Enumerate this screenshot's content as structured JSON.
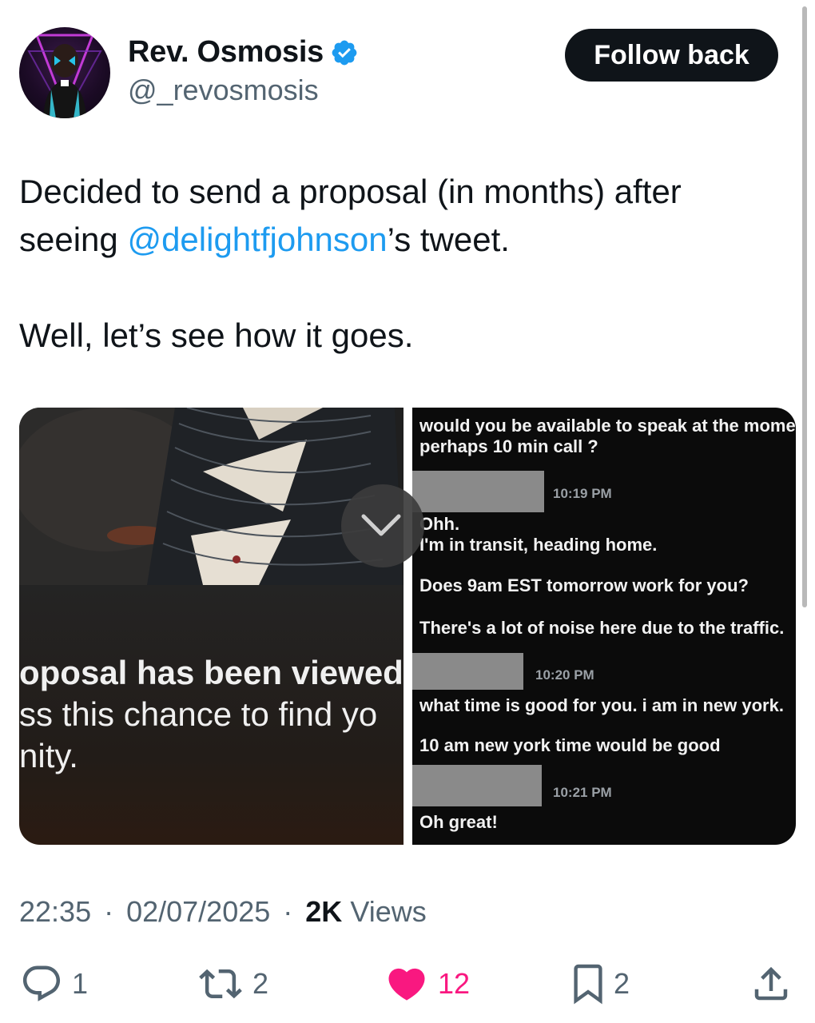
{
  "author": {
    "display_name": "Rev. Osmosis",
    "handle": "@_revosmosis",
    "verified": true,
    "follow_label": "Follow back"
  },
  "tweet": {
    "line1": "Decided to send a proposal (in months) after",
    "line2_before": "seeing ",
    "mention": "@delightfjohnson",
    "line2_after": "’s tweet.",
    "line3": "Well, let’s see how it goes."
  },
  "media_left": {
    "line1": "oposal has been viewed",
    "line2": "ss this chance to find yo",
    "line3": "nity."
  },
  "media_right": {
    "msg1_line1": "would you be available to speak at the mome",
    "msg1_line2": "perhaps 10 min call ?",
    "time1": "10:19 PM",
    "msg2_line1": "Ohh.",
    "msg2_line2": "I'm in transit, heading home.",
    "msg2_line3": "Does 9am EST tomorrow work for you?",
    "msg2_line4": "There's a lot of noise here due to the traffic.",
    "time2": "10:20 PM",
    "msg3_line1": "what time is good for you. i am in new york.",
    "msg3_line2": "10 am new york time would be good",
    "time3": "10:21 PM",
    "msg4": "Oh great!"
  },
  "meta": {
    "time": "22:35",
    "date": "02/07/2025",
    "views_count": "2K",
    "views_label": "Views"
  },
  "actions": {
    "replies": "1",
    "reposts": "2",
    "likes": "12",
    "bookmarks": "2"
  },
  "colors": {
    "accent": "#1d9bf0",
    "like": "#f91880",
    "text": "#0f1419",
    "secondary": "#536471"
  }
}
